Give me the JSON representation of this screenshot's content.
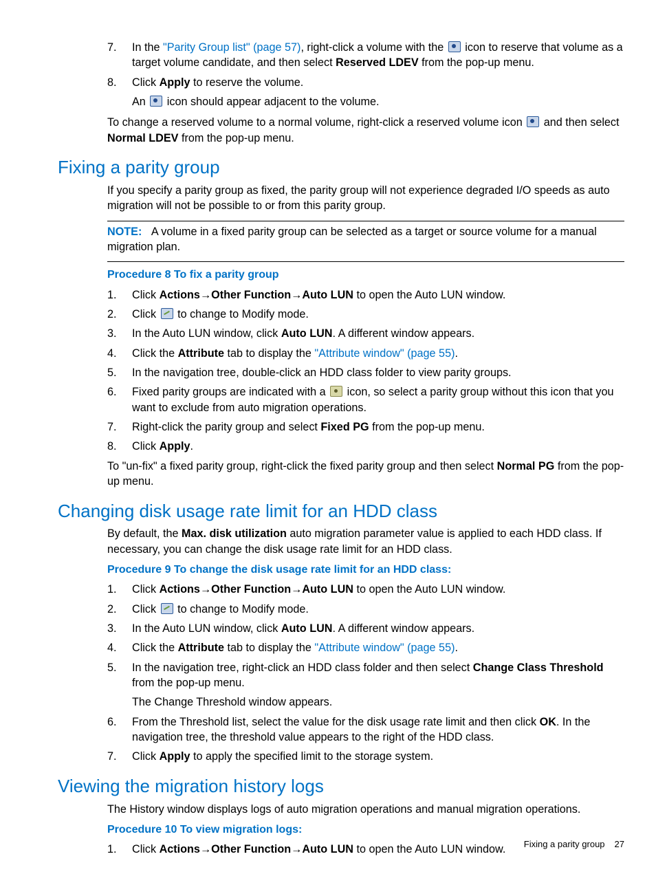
{
  "top_list": {
    "item7": {
      "num": "7.",
      "t1": "In the ",
      "link": "\"Parity Group list\" (page 57)",
      "t2": ", right-click a volume with the ",
      "t3": " icon to reserve that volume as a target volume candidate, and then select ",
      "bold": "Reserved LDEV",
      "t4": " from the pop-up menu."
    },
    "item8": {
      "num": "8.",
      "t1": "Click ",
      "bold": "Apply",
      "t2": " to reserve the volume.",
      "sub_a": "An ",
      "sub_b": " icon should appear adjacent to the volume."
    }
  },
  "top_para": {
    "t1": "To change a reserved volume to a normal volume, right-click a reserved volume icon ",
    "t2": " and then select ",
    "bold": "Normal LDEV",
    "t3": " from the pop-up menu."
  },
  "sec1": {
    "heading": "Fixing a parity group",
    "p1": "If you specify a parity group as fixed, the parity group will not experience degraded I/O speeds as auto migration will not be possible to or from this parity group.",
    "note_label": "NOTE:",
    "note": "A volume in a fixed parity group can be selected as a target or source volume for a manual migration plan.",
    "proc": "Procedure 8 To fix a parity group",
    "steps": {
      "s1": {
        "num": "1.",
        "t1": "Click ",
        "b1": "Actions",
        "arr1": "→",
        "b2": "Other Function",
        "arr2": "→",
        "b3": "Auto LUN",
        "t2": " to open the Auto LUN window."
      },
      "s2": {
        "num": "2.",
        "t1": "Click ",
        "t2": " to change to Modify mode."
      },
      "s3": {
        "num": "3.",
        "t1": "In the Auto LUN window, click ",
        "b1": "Auto LUN",
        "t2": ". A different window appears."
      },
      "s4": {
        "num": "4.",
        "t1": "Click the ",
        "b1": "Attribute",
        "t2": " tab to display the ",
        "link": "\"Attribute window\" (page 55)",
        "t3": "."
      },
      "s5": {
        "num": "5.",
        "t1": "In the navigation tree, double-click an HDD class folder to view parity groups."
      },
      "s6": {
        "num": "6.",
        "t1": "Fixed parity groups are indicated with a ",
        "t2": " icon, so select a parity group without this icon that you want to exclude from auto migration operations."
      },
      "s7": {
        "num": "7.",
        "t1": "Right-click the parity group and select ",
        "b1": "Fixed PG",
        "t2": " from the pop-up menu."
      },
      "s8": {
        "num": "8.",
        "t1": "Click ",
        "b1": "Apply",
        "t2": "."
      }
    },
    "post": {
      "t1": "To \"un-fix\" a fixed parity group, right-click the fixed parity group and then select ",
      "b1": "Normal PG",
      "t2": " from the pop-up menu."
    }
  },
  "sec2": {
    "heading": "Changing disk usage rate limit for an HDD class",
    "p1a": "By default, the ",
    "p1b": "Max. disk utilization",
    "p1c": " auto migration parameter value is applied to each HDD class. If necessary, you can change the disk usage rate limit for an HDD class.",
    "proc": "Procedure 9 To change the disk usage rate limit for an HDD class:",
    "steps": {
      "s1": {
        "num": "1.",
        "t1": "Click ",
        "b1": "Actions",
        "arr1": "→",
        "b2": "Other Function",
        "arr2": "→",
        "b3": "Auto LUN",
        "t2": " to open the Auto LUN window."
      },
      "s2": {
        "num": "2.",
        "t1": "Click ",
        "t2": " to change to Modify mode."
      },
      "s3": {
        "num": "3.",
        "t1": "In the Auto LUN window, click ",
        "b1": "Auto LUN",
        "t2": ". A different window appears."
      },
      "s4": {
        "num": "4.",
        "t1": "Click the ",
        "b1": "Attribute",
        "t2": " tab to display the ",
        "link": "\"Attribute window\" (page 55)",
        "t3": "."
      },
      "s5": {
        "num": "5.",
        "t1": "In the navigation tree, right-click an HDD class folder and then select ",
        "b1": "Change Class Threshold",
        "t2": " from the pop-up menu.",
        "sub": "The Change Threshold window appears."
      },
      "s6": {
        "num": "6.",
        "t1": "From the Threshold list, select the value for the disk usage rate limit and then click ",
        "b1": "OK",
        "t2": ". In the navigation tree, the threshold value appears to the right of the HDD class."
      },
      "s7": {
        "num": "7.",
        "t1": "Click ",
        "b1": "Apply",
        "t2": " to apply the specified limit to the storage system."
      }
    }
  },
  "sec3": {
    "heading": "Viewing the migration history logs",
    "p1": "The History window displays logs of auto migration operations and manual migration operations.",
    "proc": "Procedure 10 To view migration logs:",
    "steps": {
      "s1": {
        "num": "1.",
        "t1": "Click ",
        "b1": "Actions",
        "arr1": "→",
        "b2": "Other Function",
        "arr2": "→",
        "b3": "Auto LUN",
        "t2": " to open the Auto LUN window."
      }
    }
  },
  "footer": {
    "title": "Fixing a parity group",
    "page": "27"
  }
}
